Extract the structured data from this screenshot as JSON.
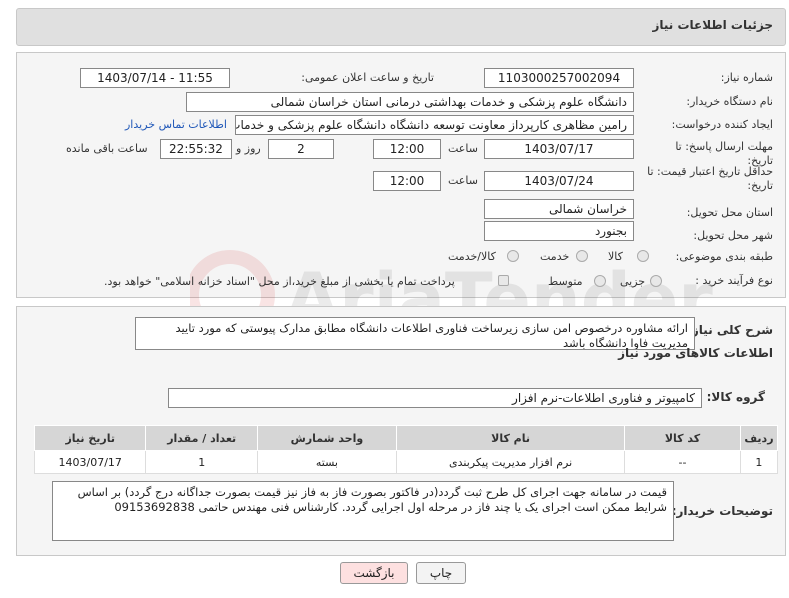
{
  "header": {
    "title": "جزئیات اطلاعات نیاز"
  },
  "form": {
    "need_number": {
      "label": "شماره نیاز:",
      "value": "1103000257002094"
    },
    "announce_date": {
      "label": "تاریخ و ساعت اعلان عمومی:",
      "value": "1403/07/14 - 11:55"
    },
    "buyer_org": {
      "label": "نام دستگاه خریدار:",
      "value": "دانشگاه علوم پزشکی و خدمات بهداشتی درمانی استان خراسان شمالی"
    },
    "creator": {
      "label": "ایجاد کننده درخواست:",
      "value": "رامین مظاهری کارپرداز معاونت توسعه دانشگاه دانشگاه علوم پزشکی و خدمات",
      "link": "اطلاعات تماس خریدار"
    },
    "reply_deadline": {
      "label": "مهلت ارسال پاسخ: تا تاریخ:",
      "date": "1403/07/17",
      "time_label": "ساعت",
      "time": "12:00",
      "days": "2",
      "days_label": "روز و",
      "remaining": "22:55:32",
      "remaining_label": "ساعت باقی مانده"
    },
    "price_validity": {
      "label": "حداقل تاریخ اعتبار قیمت: تا تاریخ:",
      "date": "1403/07/24",
      "time_label": "ساعت",
      "time": "12:00"
    },
    "province": {
      "label": "استان محل تحویل:",
      "value": "خراسان شمالی"
    },
    "city": {
      "label": "شهر محل تحویل:",
      "value": "بجنورد"
    },
    "category": {
      "label": "طبقه بندی موضوعی:",
      "options": [
        "کالا",
        "خدمت",
        "کالا/خدمت"
      ],
      "selected": "کالا"
    },
    "purchase_type": {
      "label": "نوع فرآیند خرید :",
      "options": [
        "جزیی",
        "متوسط"
      ],
      "selected": "جزیی",
      "checkbox_text": "پرداخت تمام یا بخشی از مبلغ خرید،از محل \"اسناد خزانه اسلامی\" خواهد بود."
    }
  },
  "summary": {
    "label": "شرح کلی نیاز:",
    "text": "ارائه مشاوره درخصوص امن سازی زیرساخت فناوری اطلاعات دانشگاه مطابق مدارک پیوستی که مورد تایید مدیریت فاوا دانشگاه باشد"
  },
  "goods": {
    "section_title": "اطلاعات کالاهای مورد نیاز",
    "group_label": "گروه کالا:",
    "group_value": "کامپیوتر و فناوری اطلاعات-نرم افزار",
    "columns": [
      "ردیف",
      "کد کالا",
      "نام کالا",
      "واحد شمارش",
      "تعداد / مقدار",
      "تاریخ نیاز"
    ],
    "rows": [
      [
        "1",
        "--",
        "نرم افزار مدیریت پیکربندی",
        "بسته",
        "1",
        "1403/07/17"
      ]
    ]
  },
  "buyer_notes": {
    "label": "توضیحات خریدار:",
    "text": "قیمت در سامانه جهت اجرای کل طرح ثبت گردد(در فاکتور بصورت فاز به فاز نیز قیمت بصورت جداگانه درج گردد) بر اساس شرایط ممکن است  اجرای یک یا چند فاز در مرحله اول اجرایی گردد. کارشناس فنی مهندس حاتمی 09153692838"
  },
  "buttons": {
    "print": "چاپ",
    "back": "بازگشت"
  },
  "watermark": {
    "text": "AriaTender.neT"
  },
  "colors": {
    "link": "#1f57b8",
    "back_button_bg": "#fde0e0",
    "header_bg": "#e0e0e0",
    "panel_bg": "#f5f5f5"
  }
}
